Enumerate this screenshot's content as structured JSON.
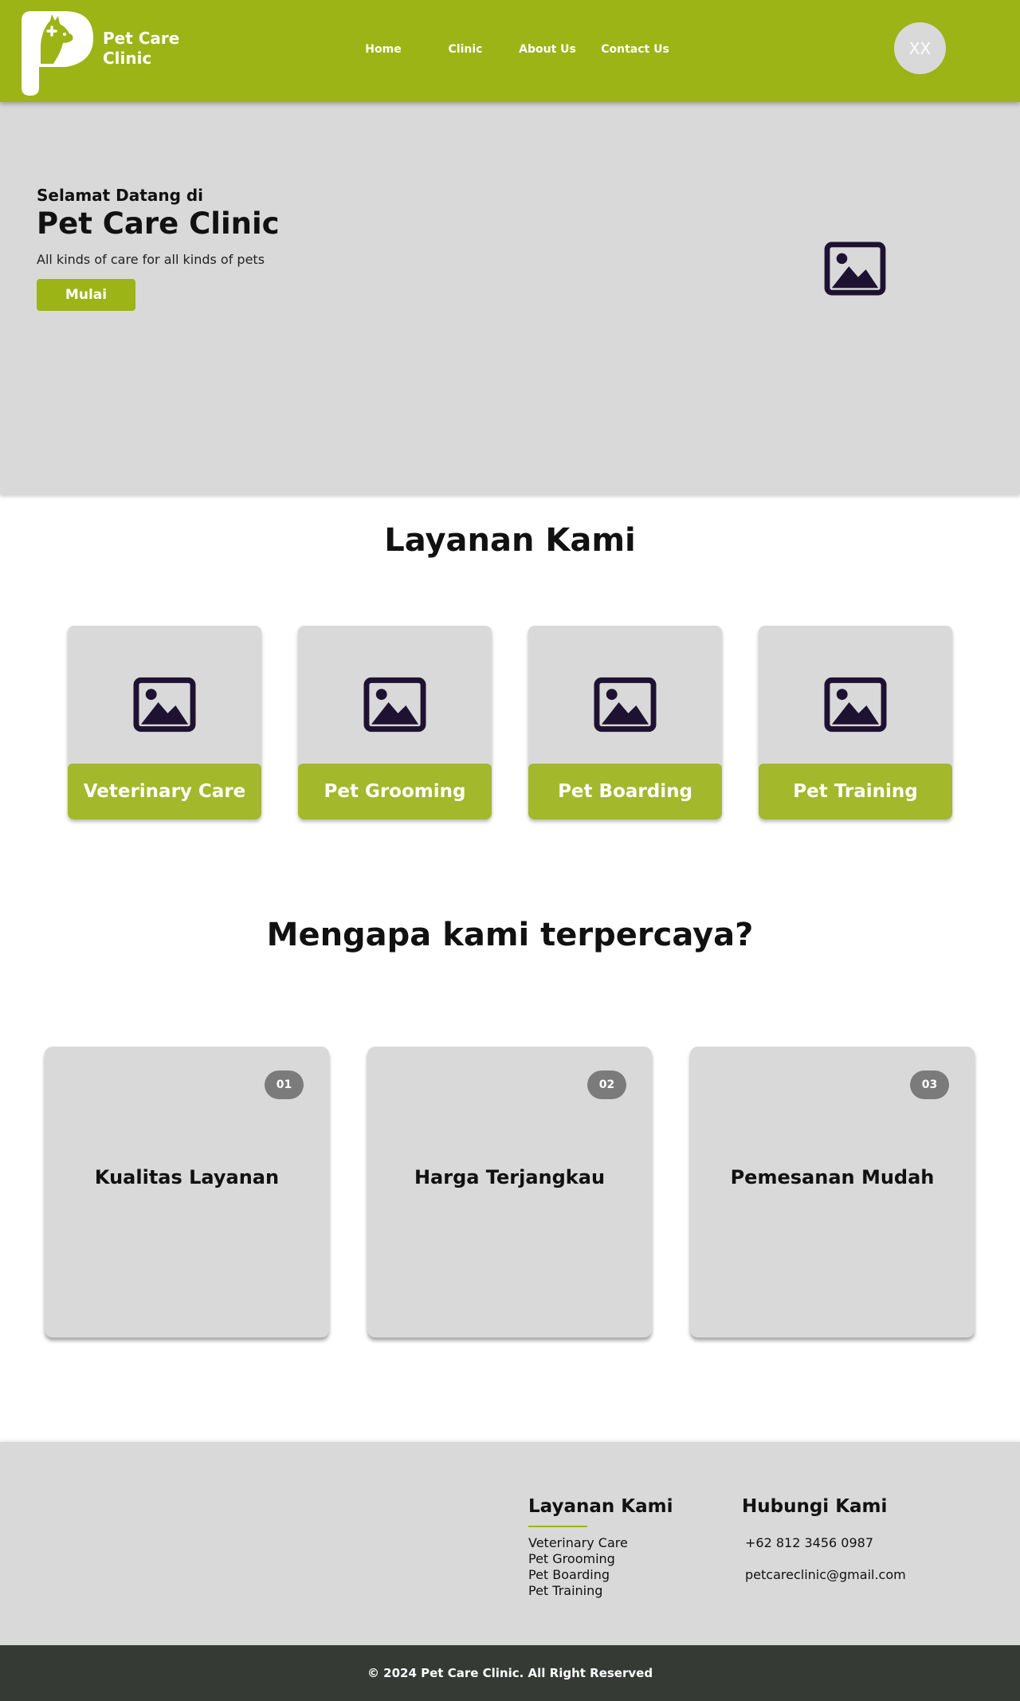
{
  "colors": {
    "brand_green": "#9cb416",
    "card_green": "#a3b82b",
    "panel_grey": "#d9d9d9",
    "footer_dark": "#353a35",
    "badge_grey": "#7b7b7b",
    "image_icon": "#1e1233"
  },
  "header": {
    "logo_icon": "paw-p-logo-icon",
    "brand_line1": "Pet Care",
    "brand_line2": "Clinic",
    "nav": [
      "Home",
      "Clinic",
      "About Us",
      "Contact Us"
    ],
    "avatar_initials": "XX"
  },
  "hero": {
    "welcome": "Selamat Datang di",
    "title": "Pet Care Clinic",
    "tagline": "All kinds of care for all kinds of pets",
    "cta": "Mulai",
    "image_icon": "image-placeholder-icon"
  },
  "services": {
    "title": "Layanan Kami",
    "items": [
      {
        "label": "Veterinary Care",
        "icon": "image-placeholder-icon"
      },
      {
        "label": "Pet Grooming",
        "icon": "image-placeholder-icon"
      },
      {
        "label": "Pet Boarding",
        "icon": "image-placeholder-icon"
      },
      {
        "label": "Pet Training",
        "icon": "image-placeholder-icon"
      }
    ]
  },
  "reasons": {
    "title": "Mengapa kami terpercaya?",
    "items": [
      {
        "number": "01",
        "label": "Kualitas Layanan"
      },
      {
        "number": "02",
        "label": "Harga Terjangkau"
      },
      {
        "number": "03",
        "label": "Pemesanan Mudah"
      }
    ]
  },
  "footer": {
    "services_title": "Layanan Kami",
    "services_list": [
      "Veterinary Care",
      "Pet Grooming",
      "Pet Boarding",
      "Pet Training"
    ],
    "contact_title": "Hubungi Kami",
    "phone": "+62 812 3456 0987",
    "email": "petcareclinic@gmail.com",
    "copyright": "© 2024 Pet Care Clinic. All Right Reserved"
  }
}
